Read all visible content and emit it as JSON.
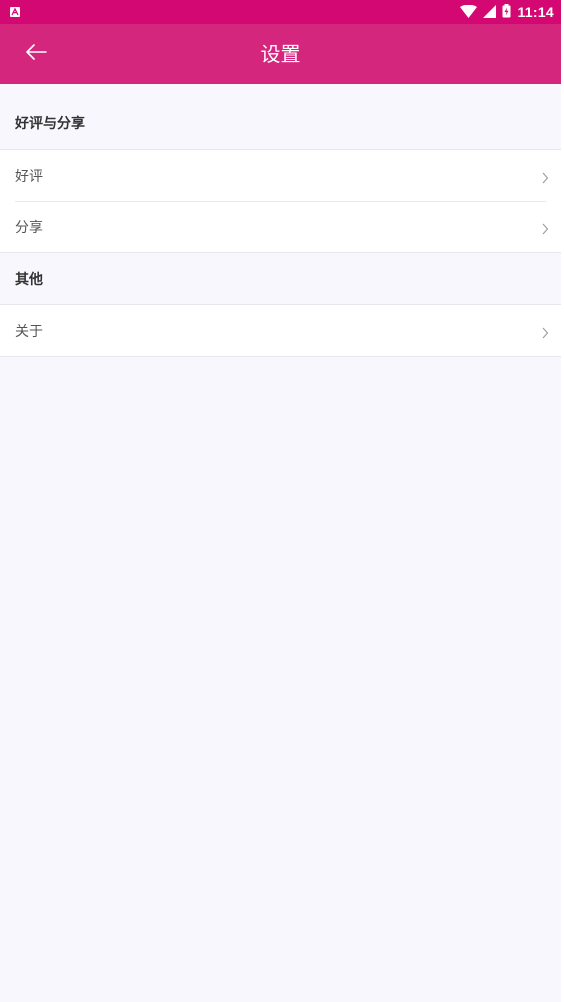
{
  "status_bar": {
    "time": "11:14",
    "icons": [
      "notification-a-icon",
      "wifi-icon",
      "signal-icon",
      "battery-icon"
    ]
  },
  "app_bar": {
    "title": "设置",
    "back_icon": "arrow-left-icon"
  },
  "sections": [
    {
      "header": "好评与分享",
      "items": [
        {
          "label": "好评",
          "icon": "chevron-right-icon"
        },
        {
          "label": "分享",
          "icon": "chevron-right-icon"
        }
      ]
    },
    {
      "header": "其他",
      "items": [
        {
          "label": "关于",
          "icon": "chevron-right-icon"
        }
      ]
    }
  ],
  "colors": {
    "status_bar": "#d40873",
    "app_bar": "#d5267e",
    "background": "#f7f7fd",
    "row_background": "#ffffff"
  }
}
